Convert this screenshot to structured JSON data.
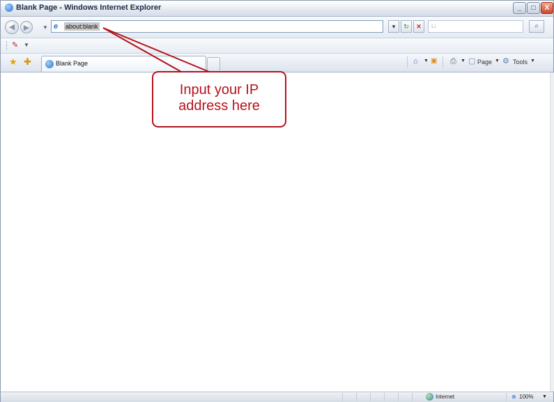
{
  "window": {
    "title": "Blank Page - Windows Internet Explorer",
    "controls": {
      "minimize": "_",
      "maximize": "□",
      "close": "X"
    }
  },
  "address_bar": {
    "url": "about:blank",
    "search_placeholder": "Li"
  },
  "tab": {
    "label": "Blank Page"
  },
  "command_bar": {
    "page_label": "Page",
    "tools_label": "Tools"
  },
  "status_bar": {
    "zone": "Internet",
    "zoom": "100%"
  },
  "callout": {
    "text": "Input your IP\naddress here",
    "color": "#b5121b"
  },
  "icons": [
    "ie-logo-icon",
    "back-icon",
    "forward-icon",
    "refresh-icon",
    "stop-icon",
    "search-icon",
    "favorites-star-icon",
    "add-favorites-icon",
    "home-icon",
    "feeds-icon",
    "print-icon",
    "page-icon",
    "tools-icon",
    "globe-icon",
    "zoom-icon"
  ]
}
